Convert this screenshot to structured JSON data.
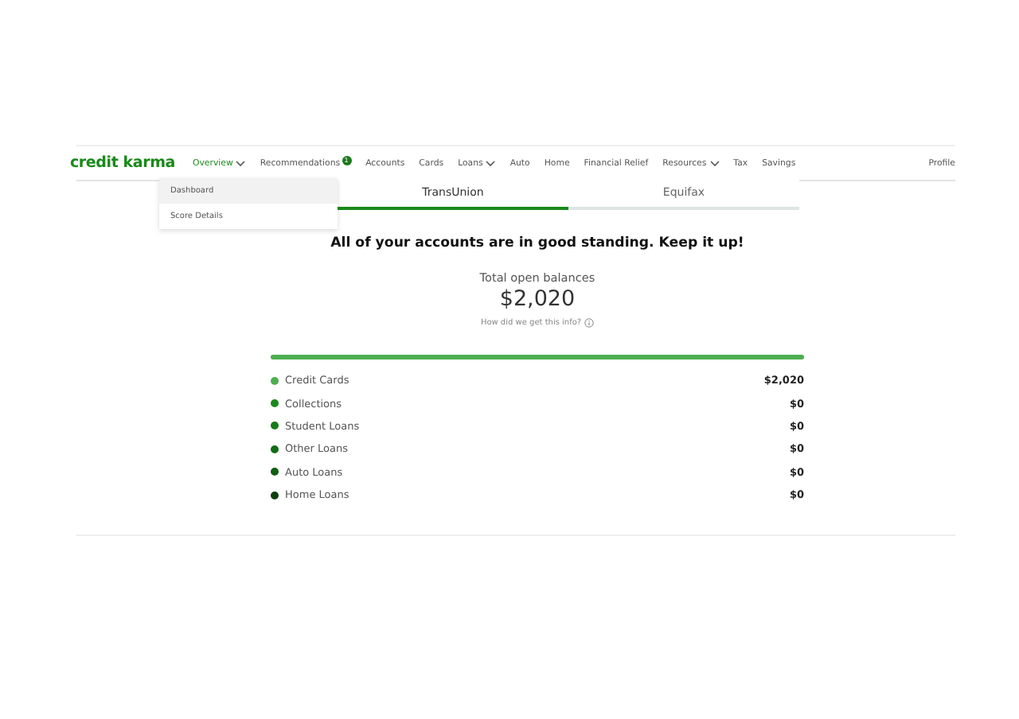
{
  "nav": {
    "logo": "credit karma",
    "items": [
      {
        "label": "Overview",
        "caret": true,
        "selected": true
      },
      {
        "label": "Recommendations",
        "caret": false,
        "selected": false,
        "badge": "1"
      },
      {
        "label": "Accounts",
        "caret": false,
        "selected": false
      },
      {
        "label": "Cards",
        "caret": false,
        "selected": false
      },
      {
        "label": "Loans",
        "caret": true,
        "selected": false
      },
      {
        "label": "Auto",
        "caret": false,
        "selected": false
      },
      {
        "label": "Home",
        "caret": false,
        "selected": false
      },
      {
        "label": "Financial Relief",
        "caret": false,
        "selected": false
      },
      {
        "label": "Resources",
        "caret": true,
        "selected": false
      },
      {
        "label": "Tax",
        "caret": false,
        "selected": false
      },
      {
        "label": "Savings",
        "caret": false,
        "selected": false
      }
    ],
    "profile": "Profile"
  },
  "dropdown": [
    {
      "label": "Dashboard",
      "selected": true
    },
    {
      "label": "Score Details",
      "selected": false
    }
  ],
  "tabs": [
    {
      "label": "TransUnion",
      "selected": true
    },
    {
      "label": "Equifax",
      "selected": false
    }
  ],
  "heading": "All of your accounts are in good standing. Keep it up!",
  "total": {
    "label": "Total open balances",
    "amount": "$2,020",
    "info": "How did we get this info?"
  },
  "bar": {
    "level": 1
  },
  "accounts": [
    {
      "name": "Credit Cards",
      "amount": "$2,020",
      "color": "#4caf50"
    },
    {
      "name": "Collections",
      "amount": "$0",
      "color": "#1b8a1b"
    },
    {
      "name": "Student Loans",
      "amount": "$0",
      "color": "#167a16"
    },
    {
      "name": "Other Loans",
      "amount": "$0",
      "color": "#126e12"
    },
    {
      "name": "Auto Loans",
      "amount": "$0",
      "color": "#0e600e"
    },
    {
      "name": "Home Loans",
      "amount": "$0",
      "color": "#0a420a"
    }
  ]
}
